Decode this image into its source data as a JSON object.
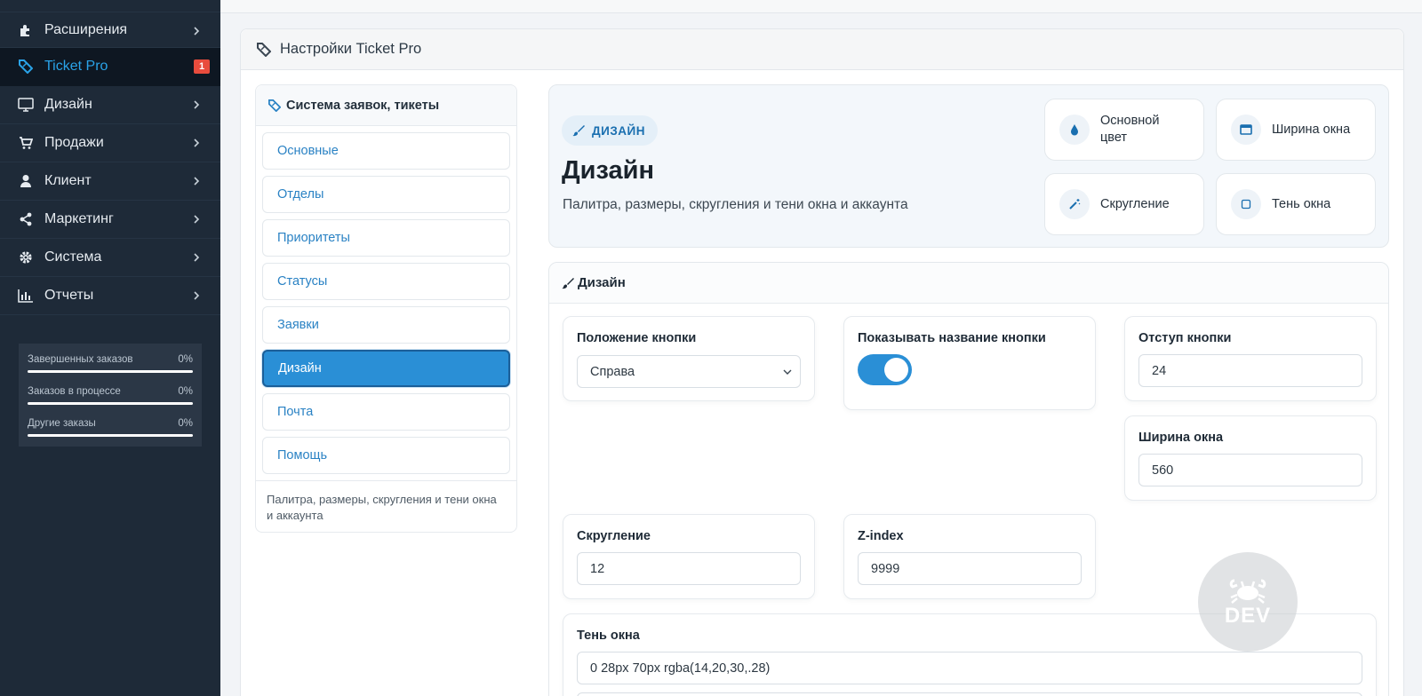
{
  "sidebar": {
    "items": [
      {
        "label": "Расширения",
        "icon": "puzzle-icon"
      },
      {
        "label": "Ticket Pro",
        "icon": "ticket-icon",
        "badge": "1"
      },
      {
        "label": "Дизайн",
        "icon": "monitor-icon"
      },
      {
        "label": "Продажи",
        "icon": "cart-icon"
      },
      {
        "label": "Клиент",
        "icon": "user-icon"
      },
      {
        "label": "Маркетинг",
        "icon": "share-icon"
      },
      {
        "label": "Система",
        "icon": "gear-icon"
      },
      {
        "label": "Отчеты",
        "icon": "bar-chart-icon"
      }
    ],
    "stats": [
      {
        "label": "Завершенных заказов",
        "value": "0%",
        "progress": 0
      },
      {
        "label": "Заказов в процессе",
        "value": "0%",
        "progress": 0
      },
      {
        "label": "Другие заказы",
        "value": "0%",
        "progress": 0
      }
    ]
  },
  "panel": {
    "title": "Настройки Ticket Pro"
  },
  "menu": {
    "title": "Система заявок, тикеты",
    "items": [
      "Основные",
      "Отделы",
      "Приоритеты",
      "Статусы",
      "Заявки",
      "Дизайн",
      "Почта",
      "Помощь"
    ],
    "active": "Дизайн",
    "note": "Палитра, размеры, скругления и тени окна и аккаунта"
  },
  "hero": {
    "pill": "ДИЗАЙН",
    "title": "Дизайн",
    "subtitle": "Палитра, размеры, скругления и тени окна и аккаунта",
    "tiles": [
      {
        "label": "Основной цвет",
        "icon": "droplet-icon"
      },
      {
        "label": "Ширина окна",
        "icon": "window-icon"
      },
      {
        "label": "Скругление",
        "icon": "magic-wand-icon"
      },
      {
        "label": "Тень окна",
        "icon": "square-icon"
      }
    ]
  },
  "section": {
    "title": "Дизайн",
    "fields": {
      "button_position": {
        "label": "Положение кнопки",
        "value": "Справа"
      },
      "show_button_name": {
        "label": "Показывать название кнопки",
        "value": true
      },
      "button_offset": {
        "label": "Отступ кнопки",
        "value": "24"
      },
      "window_width": {
        "label": "Ширина окна",
        "value": "560"
      },
      "radius": {
        "label": "Скругление",
        "value": "12"
      },
      "z_index": {
        "label": "Z-index",
        "value": "9999"
      },
      "shadow": {
        "label": "Тень окна",
        "value": "0 28px 70px rgba(14,20,30,.28)"
      }
    }
  },
  "watermark": {
    "text": "DEV"
  },
  "colors": {
    "sidebar_bg": "#1e2a38",
    "accent": "#2a8fd6",
    "badge": "#e84c3d"
  }
}
